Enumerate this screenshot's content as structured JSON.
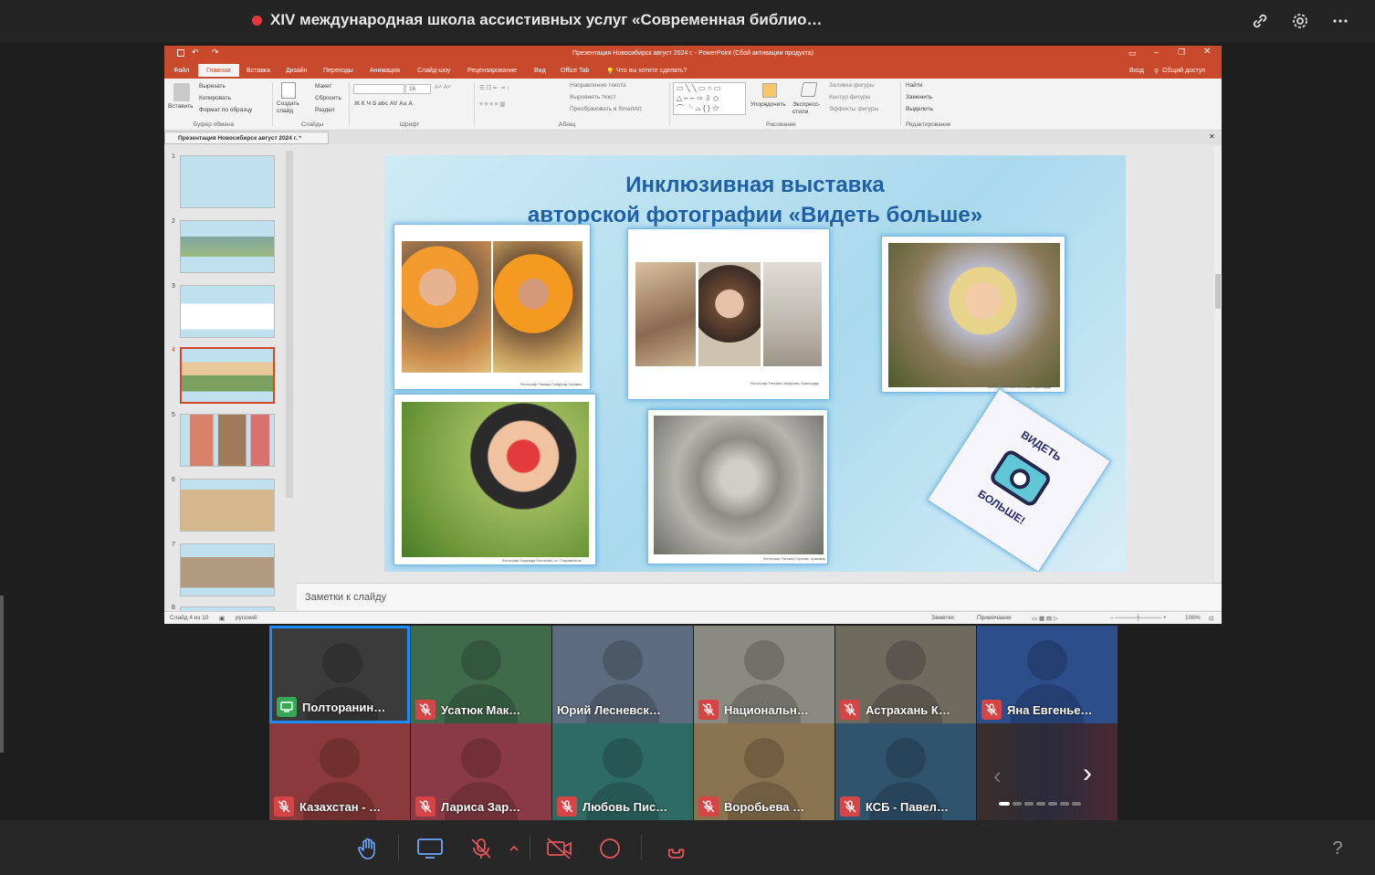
{
  "meeting": {
    "title": "XIV международная школа ассистивных услуг «Современная библио…",
    "accent": "#e5383b"
  },
  "top_icons": [
    "link-icon",
    "gear-icon",
    "more-icon"
  ],
  "ppt": {
    "window_title": "Презентация Новосибирск август 2024 г. - PowerPoint (Сбой активации продукта)",
    "accent": "#c8492b",
    "tabs": [
      "Файл",
      "Главная",
      "Вставка",
      "Дизайн",
      "Переходы",
      "Анимация",
      "Слайд-шоу",
      "Рецензирование",
      "Вид",
      "Office Tab"
    ],
    "tell_me": "Что вы хотите сделать?",
    "sign_in": "Вход",
    "share": "Общий доступ",
    "ribbon": {
      "paste": "Вставить",
      "cut": "Вырезать",
      "copy": "Копировать",
      "format_painter": "Формат по образцу",
      "clipboard_group": "Буфер обмена",
      "new_slide": "Создать слайд",
      "layout": "Макет",
      "reset": "Сбросить",
      "section": "Раздел",
      "slides_group": "Слайды",
      "font_size": "16",
      "font_group": "Шрифт",
      "paragraph_group": "Абзац",
      "text_direction": "Направление текста",
      "align_text": "Выровнять текст",
      "smartart": "Преобразовать в SmartArt",
      "arrange": "Упорядочить",
      "quick_styles": "Экспресс-стили",
      "shape_fill": "Заливка фигуры",
      "shape_outline": "Контур фигуры",
      "shape_effects": "Эффекты фигуры",
      "drawing_group": "Рисование",
      "find": "Найти",
      "replace": "Заменить",
      "select": "Выделить",
      "editing_group": "Редактирование"
    },
    "doc_tab": "Презентация Новосибирск август 2024 г. *",
    "thumb_numbers": [
      "1",
      "2",
      "3",
      "4",
      "5",
      "6",
      "7",
      "8"
    ],
    "slide": {
      "title_line1": "Инклюзивная выставка",
      "title_line2": "авторской фотографии «Видеть больше»",
      "credit1": "Фотограф Тамара Гайфрид, Крымск",
      "credit2": "Фотограф Татьяна Захарова, Краснодар",
      "credit3": "Фотограф Ольга Петрова, Краснодар",
      "credit4": "Фотограф Надежда Клочкова, ст. Старовеличк",
      "credit5": "Фотограф Татьяна Орлова, Армавир",
      "logo_text_top": "ВИДЕТЬ",
      "logo_text_bottom": "БОЛЬШЕ!"
    },
    "notes_placeholder": "Заметки к слайду",
    "status": {
      "slide_info": "Слайд 4 из 10",
      "language": "русский",
      "notes": "Заметки",
      "comments": "Примечания",
      "zoom": "106%"
    }
  },
  "participants": [
    {
      "name": "Полторанин…",
      "muted": false,
      "sharing": true,
      "color": "#3b3b3b"
    },
    {
      "name": "Усатюк Мак…",
      "muted": true,
      "sharing": false,
      "color": "#3f6b4a"
    },
    {
      "name": "Юрий Лесневск…",
      "muted": false,
      "sharing": false,
      "color": "#5c6c7e"
    },
    {
      "name": "Национальн…",
      "muted": true,
      "sharing": false,
      "color": "#8a8a80"
    },
    {
      "name": "Астрахань К…",
      "muted": true,
      "sharing": false,
      "color": "#6e6a5e"
    },
    {
      "name": "Яна Евгенье…",
      "muted": true,
      "sharing": false,
      "color": "#2c4e8a"
    },
    {
      "name": "Казахстан - …",
      "muted": true,
      "sharing": false,
      "color": "#8a3a3a"
    },
    {
      "name": "Лариса Зар…",
      "muted": true,
      "sharing": false,
      "color": "#8a3a45"
    },
    {
      "name": "Любовь Пис…",
      "muted": true,
      "sharing": false,
      "color": "#2f6b65"
    },
    {
      "name": "Воробьева …",
      "muted": true,
      "sharing": false,
      "color": "#8a7350"
    },
    {
      "name": "КСБ - Павел…",
      "muted": true,
      "sharing": false,
      "color": "#30536e"
    }
  ],
  "bottom_controls": [
    "raise-hand-icon",
    "screen-share-icon",
    "mic-off-icon",
    "chevron-up-icon",
    "camera-off-icon",
    "record-icon",
    "hang-up-icon",
    "help-icon"
  ],
  "help": "?"
}
